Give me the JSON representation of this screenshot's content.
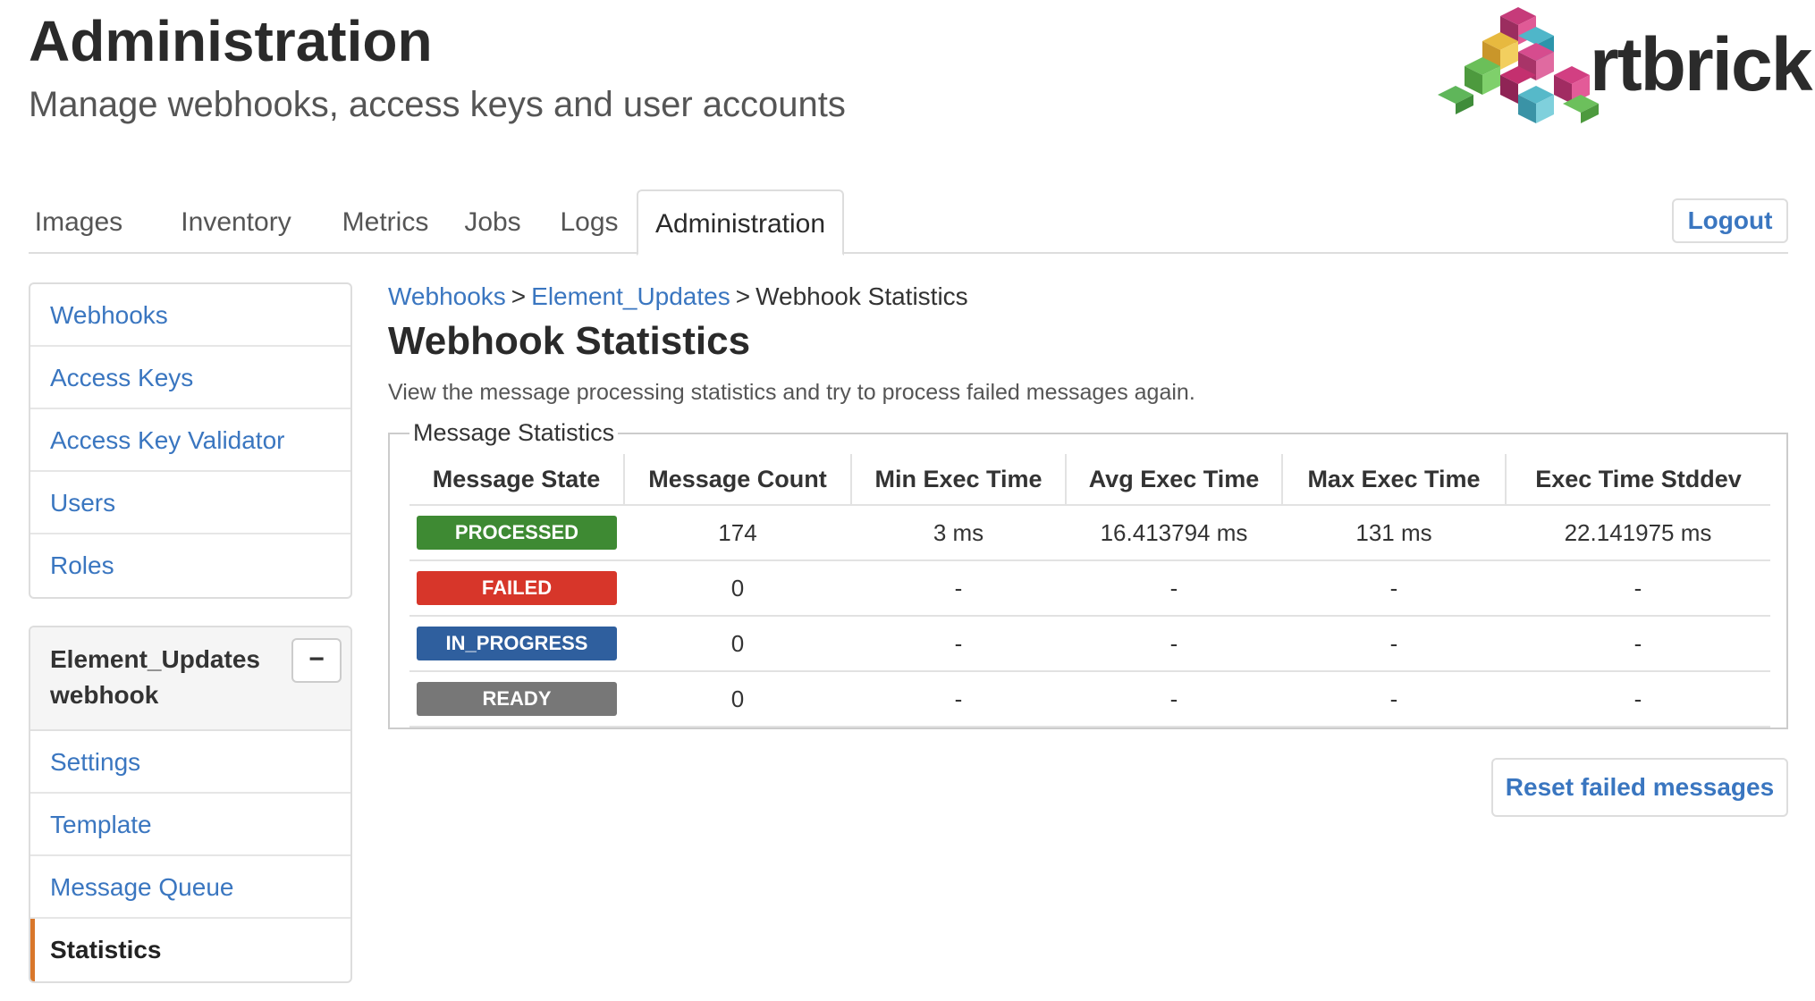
{
  "header": {
    "title": "Administration",
    "subtitle": "Manage webhooks, access keys and user accounts",
    "logo_text": "rtbrick"
  },
  "nav": {
    "tabs": [
      {
        "label": "Images"
      },
      {
        "label": "Inventory"
      },
      {
        "label": "Metrics"
      },
      {
        "label": "Jobs"
      },
      {
        "label": "Logs"
      },
      {
        "label": "Administration",
        "active": true
      }
    ],
    "logout_label": "Logout"
  },
  "sidebar": {
    "items": [
      {
        "label": "Webhooks"
      },
      {
        "label": "Access Keys"
      },
      {
        "label": "Access Key Validator"
      },
      {
        "label": "Users"
      },
      {
        "label": "Roles"
      }
    ],
    "webhook_panel": {
      "title": "Element_Updates webhook",
      "collapse_symbol": "−",
      "items": [
        {
          "label": "Settings"
        },
        {
          "label": "Template"
        },
        {
          "label": "Message Queue"
        },
        {
          "label": "Statistics",
          "active": true
        }
      ]
    }
  },
  "breadcrumb": {
    "items": [
      "Webhooks",
      "Element_Updates",
      "Webhook Statistics"
    ],
    "separator": ">"
  },
  "main": {
    "title": "Webhook Statistics",
    "description": "View the message processing statistics and try to process failed messages again.",
    "fieldset_legend": "Message Statistics",
    "table": {
      "headers": [
        "Message State",
        "Message Count",
        "Min Exec Time",
        "Avg Exec Time",
        "Max Exec Time",
        "Exec Time Stddev"
      ],
      "rows": [
        {
          "state": "PROCESSED",
          "state_color": "#3e8a33",
          "count": "174",
          "min": "3 ms",
          "avg": "16.413794 ms",
          "max": "131 ms",
          "stddev": "22.141975 ms"
        },
        {
          "state": "FAILED",
          "state_color": "#d7362a",
          "count": "0",
          "min": "-",
          "avg": "-",
          "max": "-",
          "stddev": "-"
        },
        {
          "state": "IN_PROGRESS",
          "state_color": "#2f5f9e",
          "count": "0",
          "min": "-",
          "avg": "-",
          "max": "-",
          "stddev": "-"
        },
        {
          "state": "READY",
          "state_color": "#777777",
          "count": "0",
          "min": "-",
          "avg": "-",
          "max": "-",
          "stddev": "-"
        }
      ]
    },
    "reset_button_label": "Reset failed messages"
  },
  "colors": {
    "link": "#3a76c0",
    "active_marker": "#d9772b"
  }
}
